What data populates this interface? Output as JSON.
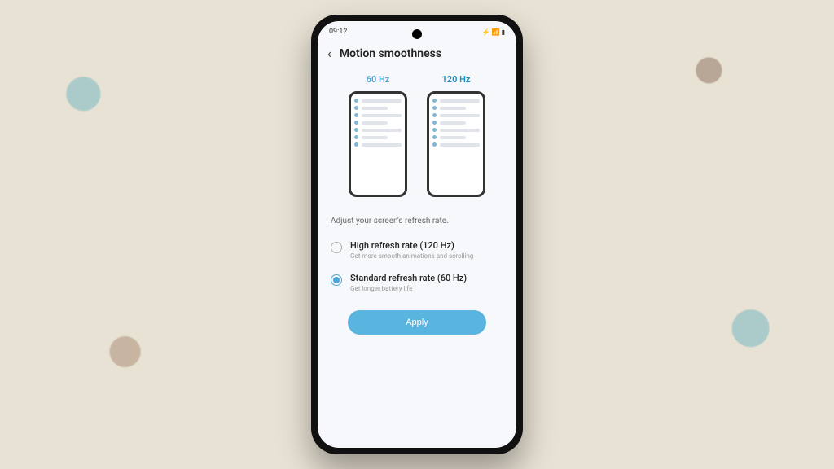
{
  "status": {
    "time": "09:12",
    "icons": "⚡ 📶 ▮"
  },
  "header": {
    "title": "Motion smoothness"
  },
  "previews": {
    "left_label": "60 Hz",
    "right_label": "120 Hz"
  },
  "description": "Adjust your screen's refresh rate.",
  "options": {
    "high": {
      "title": "High refresh rate (120 Hz)",
      "sub": "Get more smooth animations and scrolling"
    },
    "standard": {
      "title": "Standard refresh rate (60 Hz)",
      "sub": "Get longer battery life"
    }
  },
  "apply_label": "Apply"
}
